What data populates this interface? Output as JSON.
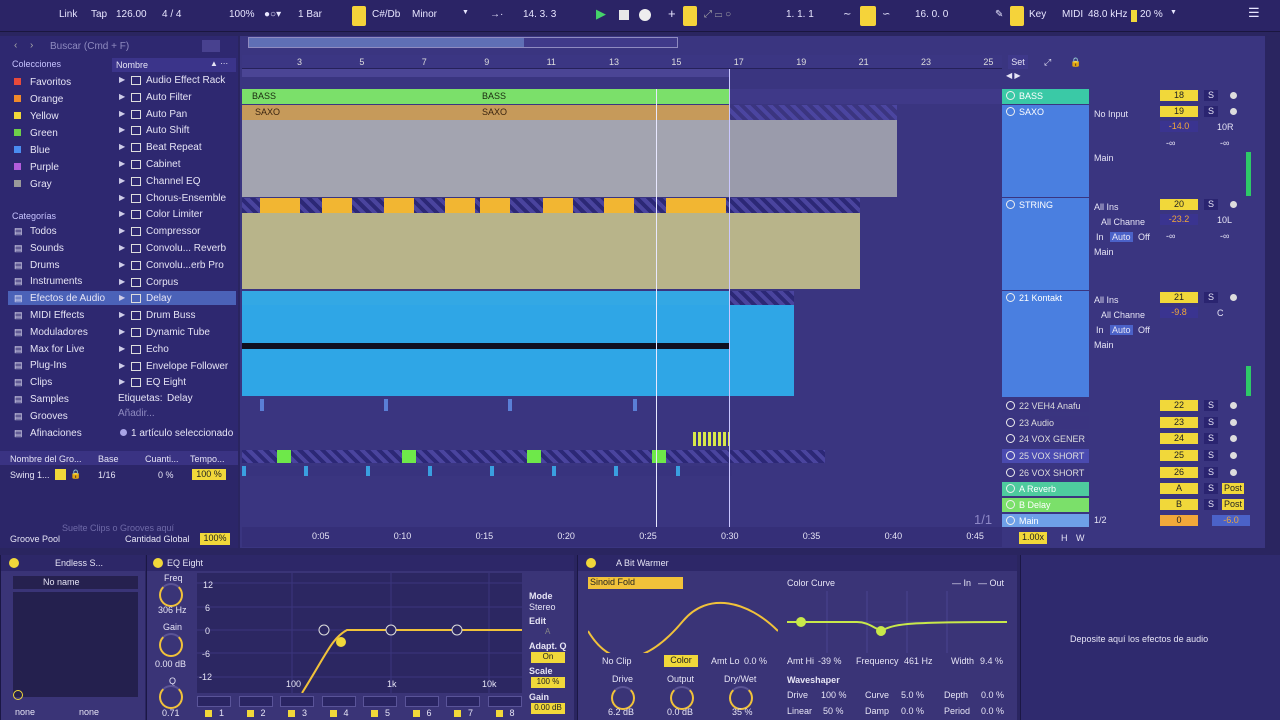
{
  "transport": {
    "link": "Link",
    "tap": "Tap",
    "tempo": "126.00",
    "signature_num": "4",
    "signature_sep": "/",
    "signature_den": "4",
    "zoom": "100%",
    "quantize": "1 Bar",
    "key": "C#/Db",
    "scale": "Minor",
    "position": "14.  3.  3",
    "loop_start": "1.  1.  1",
    "loop_length": "16.  0.  0",
    "key_label": "Key",
    "midi_label": "MIDI",
    "sample_rate": "48.0 kHz",
    "cpu": "20 %"
  },
  "browser": {
    "search_placeholder": "Buscar (Cmd + F)",
    "collections_title": "Colecciones",
    "collections": [
      {
        "label": "Favoritos",
        "color": "#e84a3a"
      },
      {
        "label": "Orange",
        "color": "#f08a2a"
      },
      {
        "label": "Yellow",
        "color": "#f1d83a"
      },
      {
        "label": "Green",
        "color": "#6ecf4a"
      },
      {
        "label": "Blue",
        "color": "#4a8cf0"
      },
      {
        "label": "Purple",
        "color": "#b25cdc"
      },
      {
        "label": "Gray",
        "color": "#9a9a9a"
      }
    ],
    "categories_title": "Categorías",
    "categories": [
      "Todos",
      "Sounds",
      "Drums",
      "Instruments",
      "Efectos de Audio",
      "MIDI Effects",
      "Moduladores",
      "Max for Live",
      "Plug-Ins",
      "Clips",
      "Samples",
      "Grooves",
      "Afinaciones"
    ],
    "selected_category": "Efectos de Audio",
    "name_header": "Nombre",
    "items": [
      "Audio Effect Rack",
      "Auto Filter",
      "Auto Pan",
      "Auto Shift",
      "Beat Repeat",
      "Cabinet",
      "Channel EQ",
      "Chorus-Ensemble",
      "Color Limiter",
      "Compressor",
      "Convolu... Reverb",
      "Convolu...erb Pro",
      "Corpus",
      "Delay",
      "Drum Buss",
      "Dynamic Tube",
      "Echo",
      "Envelope Follower",
      "EQ Eight"
    ],
    "selected_item": "Delay",
    "tags_label": "Etiquetas:",
    "tags_value": "Delay",
    "add_label": "Añadir...",
    "selection_info": "1 artículo seleccionado"
  },
  "groove": {
    "headers": [
      "Nombre del Gro...",
      "Base",
      "Cuanti...",
      "Tempo..."
    ],
    "row": {
      "name": "Swing 1...",
      "base": "1/16",
      "quant": "0 %",
      "tempo": "100 %"
    },
    "drop_hint": "Suelte Clips o Grooves aquí",
    "pool_label": "Groove Pool",
    "global_label": "Cantidad Global",
    "global_value": "100%"
  },
  "arrangement": {
    "bar_numbers": [
      "3",
      "5",
      "7",
      "9",
      "11",
      "13",
      "15",
      "17",
      "19",
      "21",
      "23",
      "25"
    ],
    "time_labels": [
      "0:05",
      "0:10",
      "0:15",
      "0:20",
      "0:25",
      "0:30",
      "0:35",
      "0:40",
      "0:45"
    ],
    "page": "1/1",
    "clips": {
      "bass_a": "BASS",
      "bass_b": "BASS",
      "saxo_a": "SAXO",
      "saxo_b": "SAXO"
    }
  },
  "tracks": [
    {
      "name": "BASS",
      "num": "18",
      "s": "S",
      "color": "#3ac9a6"
    },
    {
      "name": "SAXO",
      "num": "19",
      "s": "S",
      "input": "No Input",
      "vol": "-14.0",
      "pan": "10R",
      "out": "Main",
      "send1": "-∞",
      "send2": "-∞"
    },
    {
      "name": "STRING",
      "num": "20",
      "s": "S",
      "input": "All Ins",
      "chan": "All Channe",
      "vol": "-23.2",
      "pan": "10L",
      "out": "Main",
      "mon_in": "In",
      "mon_auto": "Auto",
      "mon_off": "Off",
      "send1": "-∞",
      "send2": "-∞"
    },
    {
      "name": "21 Kontakt",
      "num": "21",
      "s": "S",
      "input": "All Ins",
      "chan": "All Channe",
      "vol": "-9.8",
      "pan": "C",
      "out": "Main",
      "mon_in": "In",
      "mon_auto": "Auto",
      "mon_off": "Off"
    },
    {
      "name": "22 VEH4 Anafu",
      "num": "22",
      "s": "S"
    },
    {
      "name": "23 Audio",
      "num": "23",
      "s": "S"
    },
    {
      "name": "24 VOX GENER",
      "num": "24",
      "s": "S"
    },
    {
      "name": "25 VOX SHORT",
      "num": "25",
      "s": "S"
    },
    {
      "name": "26 VOX SHORT",
      "num": "26",
      "s": "S"
    },
    {
      "name": "A Reverb",
      "num": "A",
      "s": "S",
      "post": "Post"
    },
    {
      "name": "B Delay",
      "num": "B",
      "s": "S",
      "post": "Post"
    },
    {
      "name": "Main",
      "num": "0",
      "vol": "-6.0",
      "cue": "1/2"
    }
  ],
  "master": {
    "set": "Set",
    "zoom": "1.00x",
    "h": "H",
    "w": "W"
  },
  "devices": {
    "endless": {
      "title": "Endless S...",
      "preset": "No name",
      "sel1": "none",
      "sel2": "none"
    },
    "eq": {
      "title": "EQ Eight",
      "freq_label": "Freq",
      "freq": "306 Hz",
      "gain_label": "Gain",
      "gain": "0.00 dB",
      "q_label": "Q",
      "q": "0.71",
      "db_ticks": [
        "12",
        "6",
        "0",
        "-6",
        "-12"
      ],
      "hz_ticks": [
        "100",
        "1k",
        "10k"
      ],
      "mode_label": "Mode",
      "mode": "Stereo",
      "edit_label": "Edit",
      "edit_val": "A",
      "adaptq_label": "Adapt. Q",
      "adaptq": "On",
      "scale_label": "Scale",
      "scale": "100 %",
      "gain2_label": "Gain",
      "gain2": "0.00 dB",
      "bands": [
        "1",
        "2",
        "3",
        "4",
        "5",
        "6",
        "7",
        "8"
      ]
    },
    "warmer": {
      "title": "A Bit Warmer",
      "shape": "Sinoid Fold",
      "noclip": "No Clip",
      "color": "Color",
      "amt_lo_label": "Amt Lo",
      "amt_lo": "0.0 %",
      "drive_label": "Drive",
      "drive": "6.2 dB",
      "output_label": "Output",
      "output": "0.0 dB",
      "drywet_label": "Dry/Wet",
      "drywet": "35 %",
      "curve_title": "Color Curve",
      "legend_in": "In",
      "legend_out": "Out",
      "amt_hi_label": "Amt Hi",
      "amt_hi": "-39 %",
      "freq_label": "Frequency",
      "freq": "461 Hz",
      "width_label": "Width",
      "width": "9.4 %",
      "ws_title": "Waveshaper",
      "ws_drive_label": "Drive",
      "ws_drive": "100 %",
      "ws_curve_label": "Curve",
      "ws_curve": "5.0 %",
      "ws_depth_label": "Depth",
      "ws_depth": "0.0 %",
      "ws_linear_label": "Linear",
      "ws_linear": "50 %",
      "ws_damp_label": "Damp",
      "ws_damp": "0.0 %",
      "ws_period_label": "Period",
      "ws_period": "0.0 %"
    },
    "drop_hint": "Deposite aquí los efectos de audio"
  }
}
